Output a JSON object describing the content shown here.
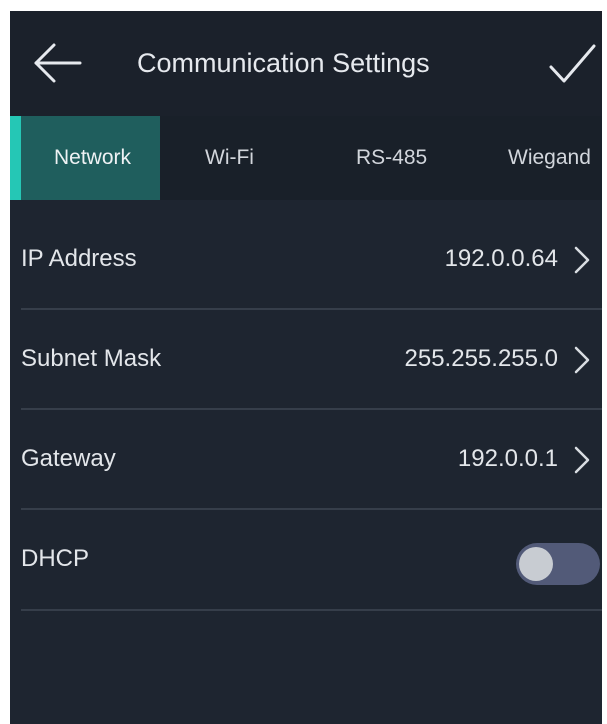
{
  "header": {
    "title": "Communication Settings",
    "back_icon": "arrow-left-icon",
    "confirm_icon": "checkmark-icon"
  },
  "tabs": [
    {
      "label": "Network",
      "active": true
    },
    {
      "label": "Wi-Fi",
      "active": false
    },
    {
      "label": "RS-485",
      "active": false
    },
    {
      "label": "Wiegand",
      "active": false
    }
  ],
  "settings": {
    "ip_address": {
      "label": "IP Address",
      "value": "192.0.0.64"
    },
    "subnet_mask": {
      "label": "Subnet Mask",
      "value": "255.255.255.0"
    },
    "gateway": {
      "label": "Gateway",
      "value": "192.0.0.1"
    },
    "dhcp": {
      "label": "DHCP",
      "enabled": false
    }
  },
  "colors": {
    "background": "#1e2530",
    "active_tab_background": "#1f5e5d",
    "accent": "#25c7b5",
    "text": "#e3e6ea",
    "toggle_off_track": "#525a78"
  }
}
